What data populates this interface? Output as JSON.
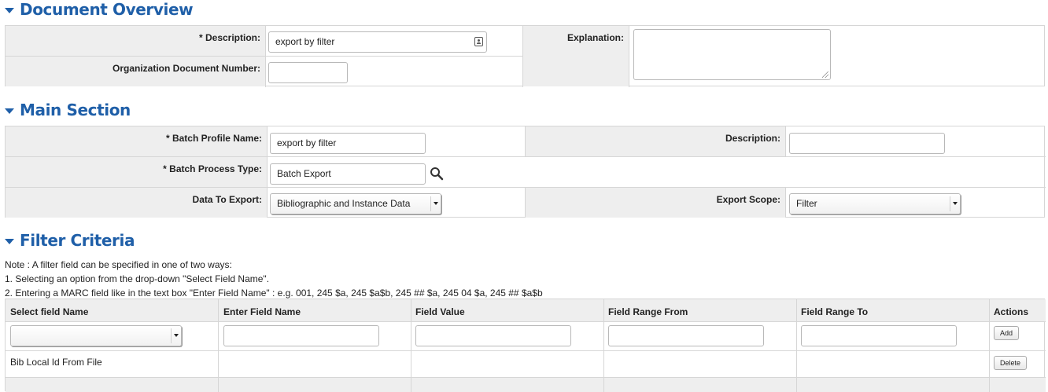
{
  "document_overview": {
    "title": "Document Overview",
    "description_label": "* Description:",
    "description_value": "export by filter",
    "org_doc_number_label": "Organization Document Number:",
    "org_doc_number_value": "",
    "explanation_label": "Explanation:",
    "explanation_value": ""
  },
  "main_section": {
    "title": "Main Section",
    "batch_profile_name_label": "* Batch Profile Name:",
    "batch_profile_name_value": "export by filter",
    "description_label": "Description:",
    "description_value": "",
    "batch_process_type_label": "* Batch Process Type:",
    "batch_process_type_value": "Batch Export",
    "data_to_export_label": "Data To Export:",
    "data_to_export_value": "Bibliographic and Instance Data",
    "export_scope_label": "Export Scope:",
    "export_scope_value": "Filter"
  },
  "filter_criteria": {
    "title": "Filter Criteria",
    "note_lines": [
      "Note : A filter field can be specified in one of two ways:",
      "1. Selecting an option from the drop-down \"Select Field Name\".",
      "2. Entering a MARC field like in the text box \"Enter Field Name\" : e.g. 001, 245 $a, 245 $a$b, 245 ## $a, 245 04 $a, 245 ## $a$b"
    ],
    "columns": [
      "Select field Name",
      "Enter Field Name",
      "Field Value",
      "Field Range From",
      "Field Range To",
      "Actions"
    ],
    "add_button": "Add",
    "rows": [
      {
        "select_field_name": "Bib Local Id From File",
        "enter_field_name": "",
        "field_value": "",
        "range_from": "",
        "range_to": "",
        "action": "Delete"
      }
    ]
  },
  "colors": {
    "heading": "#1f5fa8",
    "label_bg": "#eeeeee",
    "border": "#d6d6d6"
  }
}
